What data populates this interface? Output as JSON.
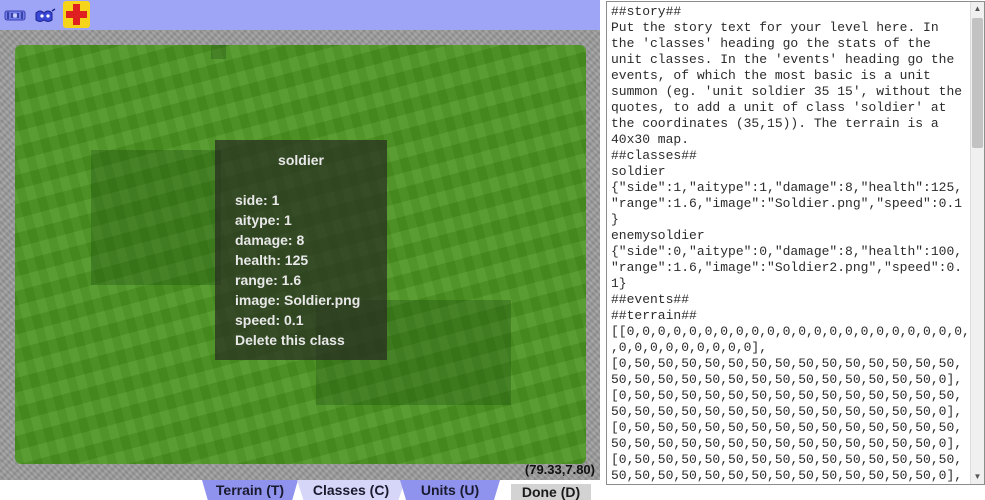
{
  "toolbar": {
    "tools": [
      {
        "icon": "selection-tool-icon"
      },
      {
        "icon": "unit-tool-icon"
      },
      {
        "icon": "plus-icon",
        "color": "#e02020",
        "bg": "#f6d41a"
      }
    ]
  },
  "class_panel": {
    "name": "soldier",
    "stats": {
      "side": "side: 1",
      "aitype": "aitype: 1",
      "damage": "damage: 8",
      "health": "health: 125",
      "range": "range: 1.6",
      "image": "image: Soldier.png",
      "speed": "speed: 0.1"
    },
    "delete_label": "Delete this class"
  },
  "coords": "(79.33,7.80)",
  "tabs": {
    "terrain": "Terrain (T)",
    "classes": "Classes (C)",
    "units": "Units (U)",
    "active": "classes"
  },
  "done_label": "Done (D)",
  "editor_text": "##story##\nPut the story text for your level here. In\nthe 'classes' heading go the stats of the\nunit classes. In the 'events' heading go the\nevents, of which the most basic is a unit\nsummon (eg. 'unit soldier 35 15', without the\nquotes, to add a unit of class 'soldier' at\nthe coordinates (35,15)). The terrain is a\n40x30 map.\n##classes##\nsoldier\n{\"side\":1,\"aitype\":1,\"damage\":8,\"health\":125,\n\"range\":1.6,\"image\":\"Soldier.png\",\"speed\":0.1\n}\nenemysoldier\n{\"side\":0,\"aitype\":0,\"damage\":8,\"health\":100,\n\"range\":1.6,\"image\":\"Soldier2.png\",\"speed\":0.\n1}\n##events##\n##terrain##\n[[0,0,0,0,0,0,0,0,0,0,0,0,0,0,0,0,0,0,0,0,0,0,0\n,0,0,0,0,0,0,0,0,0],\n[0,50,50,50,50,50,50,50,50,50,50,50,50,50,50,\n50,50,50,50,50,50,50,50,50,50,50,50,50,50,0],\n[0,50,50,50,50,50,50,50,50,50,50,50,50,50,50,\n50,50,50,50,50,50,50,50,50,50,50,50,50,50,0],\n[0,50,50,50,50,50,50,50,50,50,50,50,50,50,50,\n50,50,50,50,50,50,50,50,50,50,50,50,50,50,0],\n[0,50,50,50,50,50,50,50,50,50,50,50,50,50,50,\n50,50,50,50,50,50,50,50,50,50,50,50,50,50,0],"
}
